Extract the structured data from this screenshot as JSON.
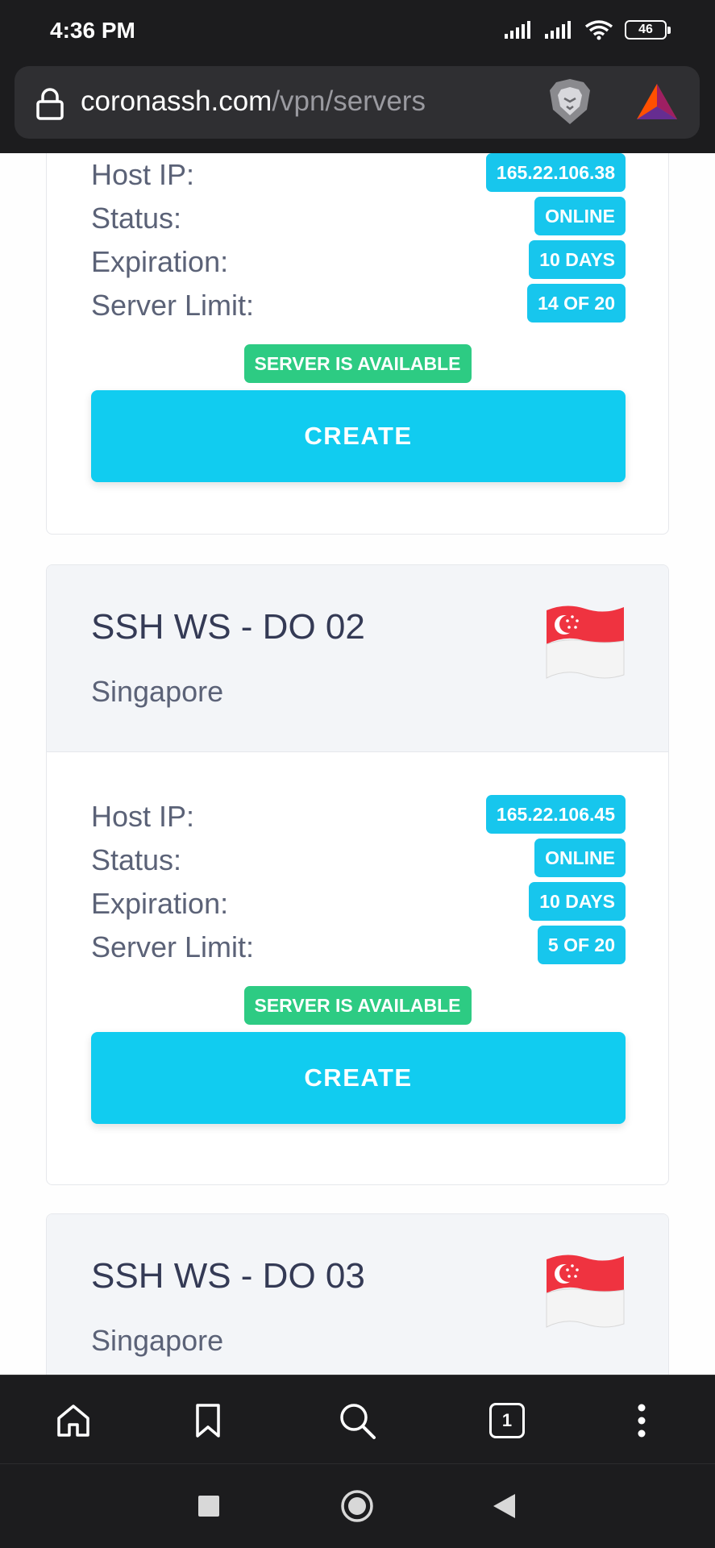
{
  "status_bar": {
    "time": "4:36 PM",
    "battery": "46"
  },
  "url_bar": {
    "host": "coronassh.com",
    "path": "/vpn/servers"
  },
  "cards": [
    {
      "rows": [
        {
          "label": "Host IP:",
          "value": "165.22.106.38"
        },
        {
          "label": "Status:",
          "value": "ONLINE"
        },
        {
          "label": "Expiration:",
          "value": "10 DAYS"
        },
        {
          "label": "Server Limit:",
          "value": "14 OF 20"
        }
      ],
      "availability": "SERVER IS AVAILABLE",
      "button": "CREATE"
    },
    {
      "name": "SSH WS - DO 02",
      "location": "Singapore",
      "rows": [
        {
          "label": "Host IP:",
          "value": "165.22.106.45"
        },
        {
          "label": "Status:",
          "value": "ONLINE"
        },
        {
          "label": "Expiration:",
          "value": "10 DAYS"
        },
        {
          "label": "Server Limit:",
          "value": "5 OF 20"
        }
      ],
      "availability": "SERVER IS AVAILABLE",
      "button": "CREATE"
    },
    {
      "name": "SSH WS - DO 03",
      "location": "Singapore"
    }
  ],
  "toolbar": {
    "tab_count": "1",
    "icons": [
      "home-icon",
      "bookmark-icon",
      "search-icon",
      "tabs-icon",
      "more-icon"
    ]
  },
  "nav": {
    "icons": [
      "recents-icon",
      "home-icon",
      "back-icon"
    ]
  },
  "colors": {
    "badge": "#17c6ed",
    "available": "#2dcb83",
    "create": "#11ccf0"
  }
}
